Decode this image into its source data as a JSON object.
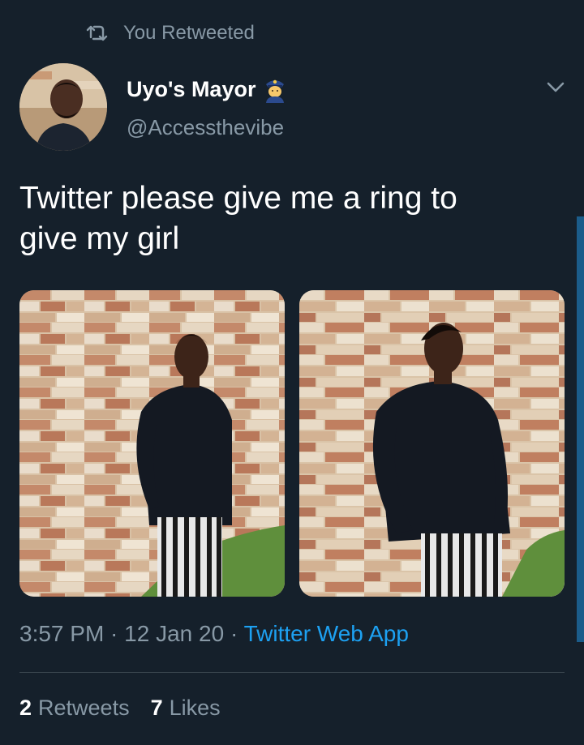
{
  "retweet_context": {
    "label": "You Retweeted",
    "icon": "retweet-icon"
  },
  "author": {
    "display_name": "Uyo's Mayor",
    "name_emoji": "police-officer-emoji",
    "handle": "@Accessthevibe",
    "avatar_icon": "profile-photo"
  },
  "tweet": {
    "text_line1": "Twitter please give me a ring to",
    "text_line2": "give my girl"
  },
  "media": [
    {
      "kind": "photo",
      "subject": "man in black shirt against brick wall, facing camera"
    },
    {
      "kind": "photo",
      "subject": "man in black shirt against brick wall, profile view"
    }
  ],
  "meta": {
    "time": "3:57 PM",
    "sep1": " · ",
    "date": "12 Jan 20",
    "sep2": " · ",
    "source": "Twitter Web App"
  },
  "stats": {
    "retweets_count": "2",
    "retweets_label": "Retweets",
    "likes_count": "7",
    "likes_label": "Likes"
  },
  "colors": {
    "background": "#15202b",
    "secondary_text": "#8899a6",
    "link": "#1da1f2",
    "divider": "#38444d"
  }
}
